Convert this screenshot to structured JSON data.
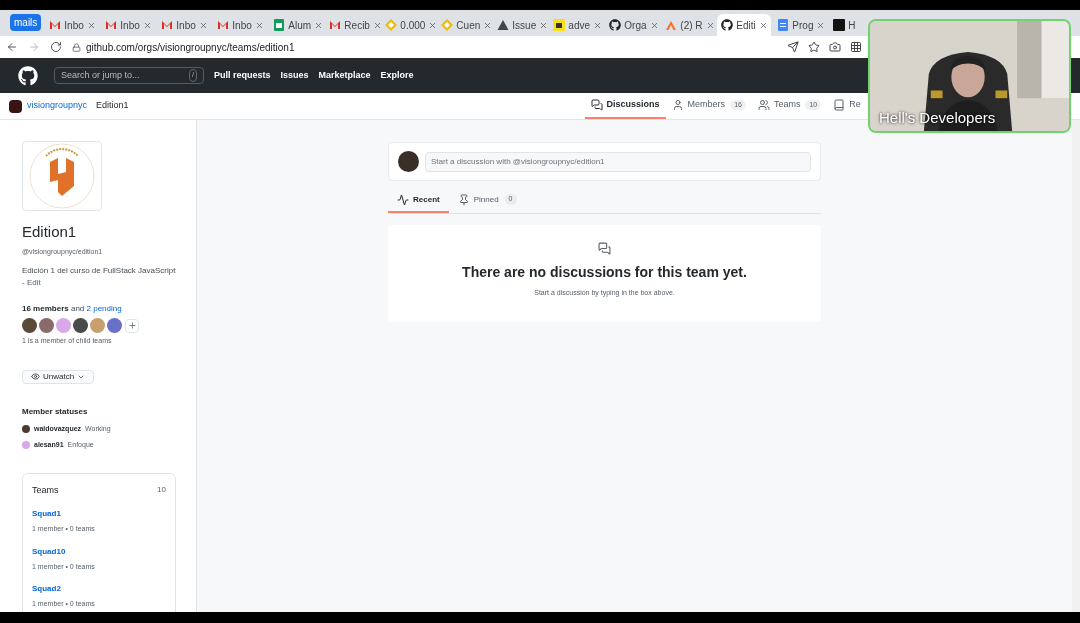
{
  "browser": {
    "tab_group": "mails",
    "address": "github.com/orgs/visiongroupnyc/teams/edition1",
    "tabs": [
      {
        "kind": "gmail",
        "title": "Inbo",
        "selected": false
      },
      {
        "kind": "gmail",
        "title": "Inbo",
        "selected": false
      },
      {
        "kind": "gmail",
        "title": "Inbo",
        "selected": false
      },
      {
        "kind": "gmail",
        "title": "Inbo",
        "selected": false
      },
      {
        "kind": "sheets",
        "title": "Alum",
        "selected": false
      },
      {
        "kind": "gmail",
        "title": "Recib",
        "selected": false
      },
      {
        "kind": "coin",
        "title": "0.000",
        "selected": false
      },
      {
        "kind": "coin",
        "title": "Cuen",
        "selected": false
      },
      {
        "kind": "warning",
        "title": "Issue",
        "selected": false
      },
      {
        "kind": "js",
        "title": "adve",
        "selected": false
      },
      {
        "kind": "github",
        "title": "Orga",
        "selected": false
      },
      {
        "kind": "hand",
        "title": "(2) R",
        "selected": false
      },
      {
        "kind": "github",
        "title": "Editi",
        "selected": true
      },
      {
        "kind": "docs",
        "title": "Prog",
        "selected": false
      },
      {
        "kind": "dark",
        "title": "H",
        "selected": false
      }
    ]
  },
  "header": {
    "search_placeholder": "Search or jump to...",
    "shortcut": "/",
    "links": [
      "Pull requests",
      "Issues",
      "Marketplace",
      "Explore"
    ]
  },
  "breadcrumb": {
    "org": "visiongroupnyc",
    "team": "Edition1"
  },
  "nav": [
    {
      "kind": "discussions",
      "label": "Discussions",
      "selected": true
    },
    {
      "kind": "members",
      "label": "Members",
      "count": "16",
      "selected": false
    },
    {
      "kind": "teams",
      "label": "Teams",
      "count": "10",
      "selected": false
    },
    {
      "kind": "repos",
      "label": "Re",
      "selected": false
    }
  ],
  "team": {
    "name": "Edition1",
    "handle": "@visiongroupnyc/edition1",
    "description": "Edición 1 del curso de FullStack JavaScript",
    "edit": "- Edit",
    "members_count": "16 members",
    "and": "and",
    "pending": "2 pending",
    "child_note": "1 is a member of child teams",
    "watch_button": "Unwatch",
    "avatars": [
      {
        "color": "#5a4a3a"
      },
      {
        "color": "#8a6a6a"
      },
      {
        "color": "#d8a8e8"
      },
      {
        "color": "#4a4a4a"
      },
      {
        "color": "#c8a070"
      },
      {
        "color": "#6a70c8"
      }
    ]
  },
  "member_statuses": {
    "title": "Member statuses",
    "items": [
      {
        "user": "waldovazquez",
        "status": "Working",
        "color": "#4a3a30"
      },
      {
        "user": "alesan91",
        "status": "Enfoque",
        "color": "#d8a8e8"
      }
    ]
  },
  "teams_box": {
    "title": "Teams",
    "count": "10",
    "items": [
      {
        "name": "Squad1",
        "meta": "1 member • 0 teams"
      },
      {
        "name": "Squad10",
        "meta": "1 member • 0 teams"
      },
      {
        "name": "Squad2",
        "meta": "1 member • 0 teams"
      }
    ]
  },
  "composer": {
    "placeholder": "Start a discussion with @visiongroupnyc/edition1"
  },
  "subtabs": [
    {
      "kind": "recent",
      "label": "Recent",
      "selected": true
    },
    {
      "kind": "pinned",
      "label": "Pinned",
      "count": "0",
      "selected": false
    }
  ],
  "empty": {
    "title": "There are no discussions for this team yet.",
    "hint": "Start a discussion by typing in the box above."
  },
  "webcam": {
    "caption": "Hell's Developers"
  }
}
